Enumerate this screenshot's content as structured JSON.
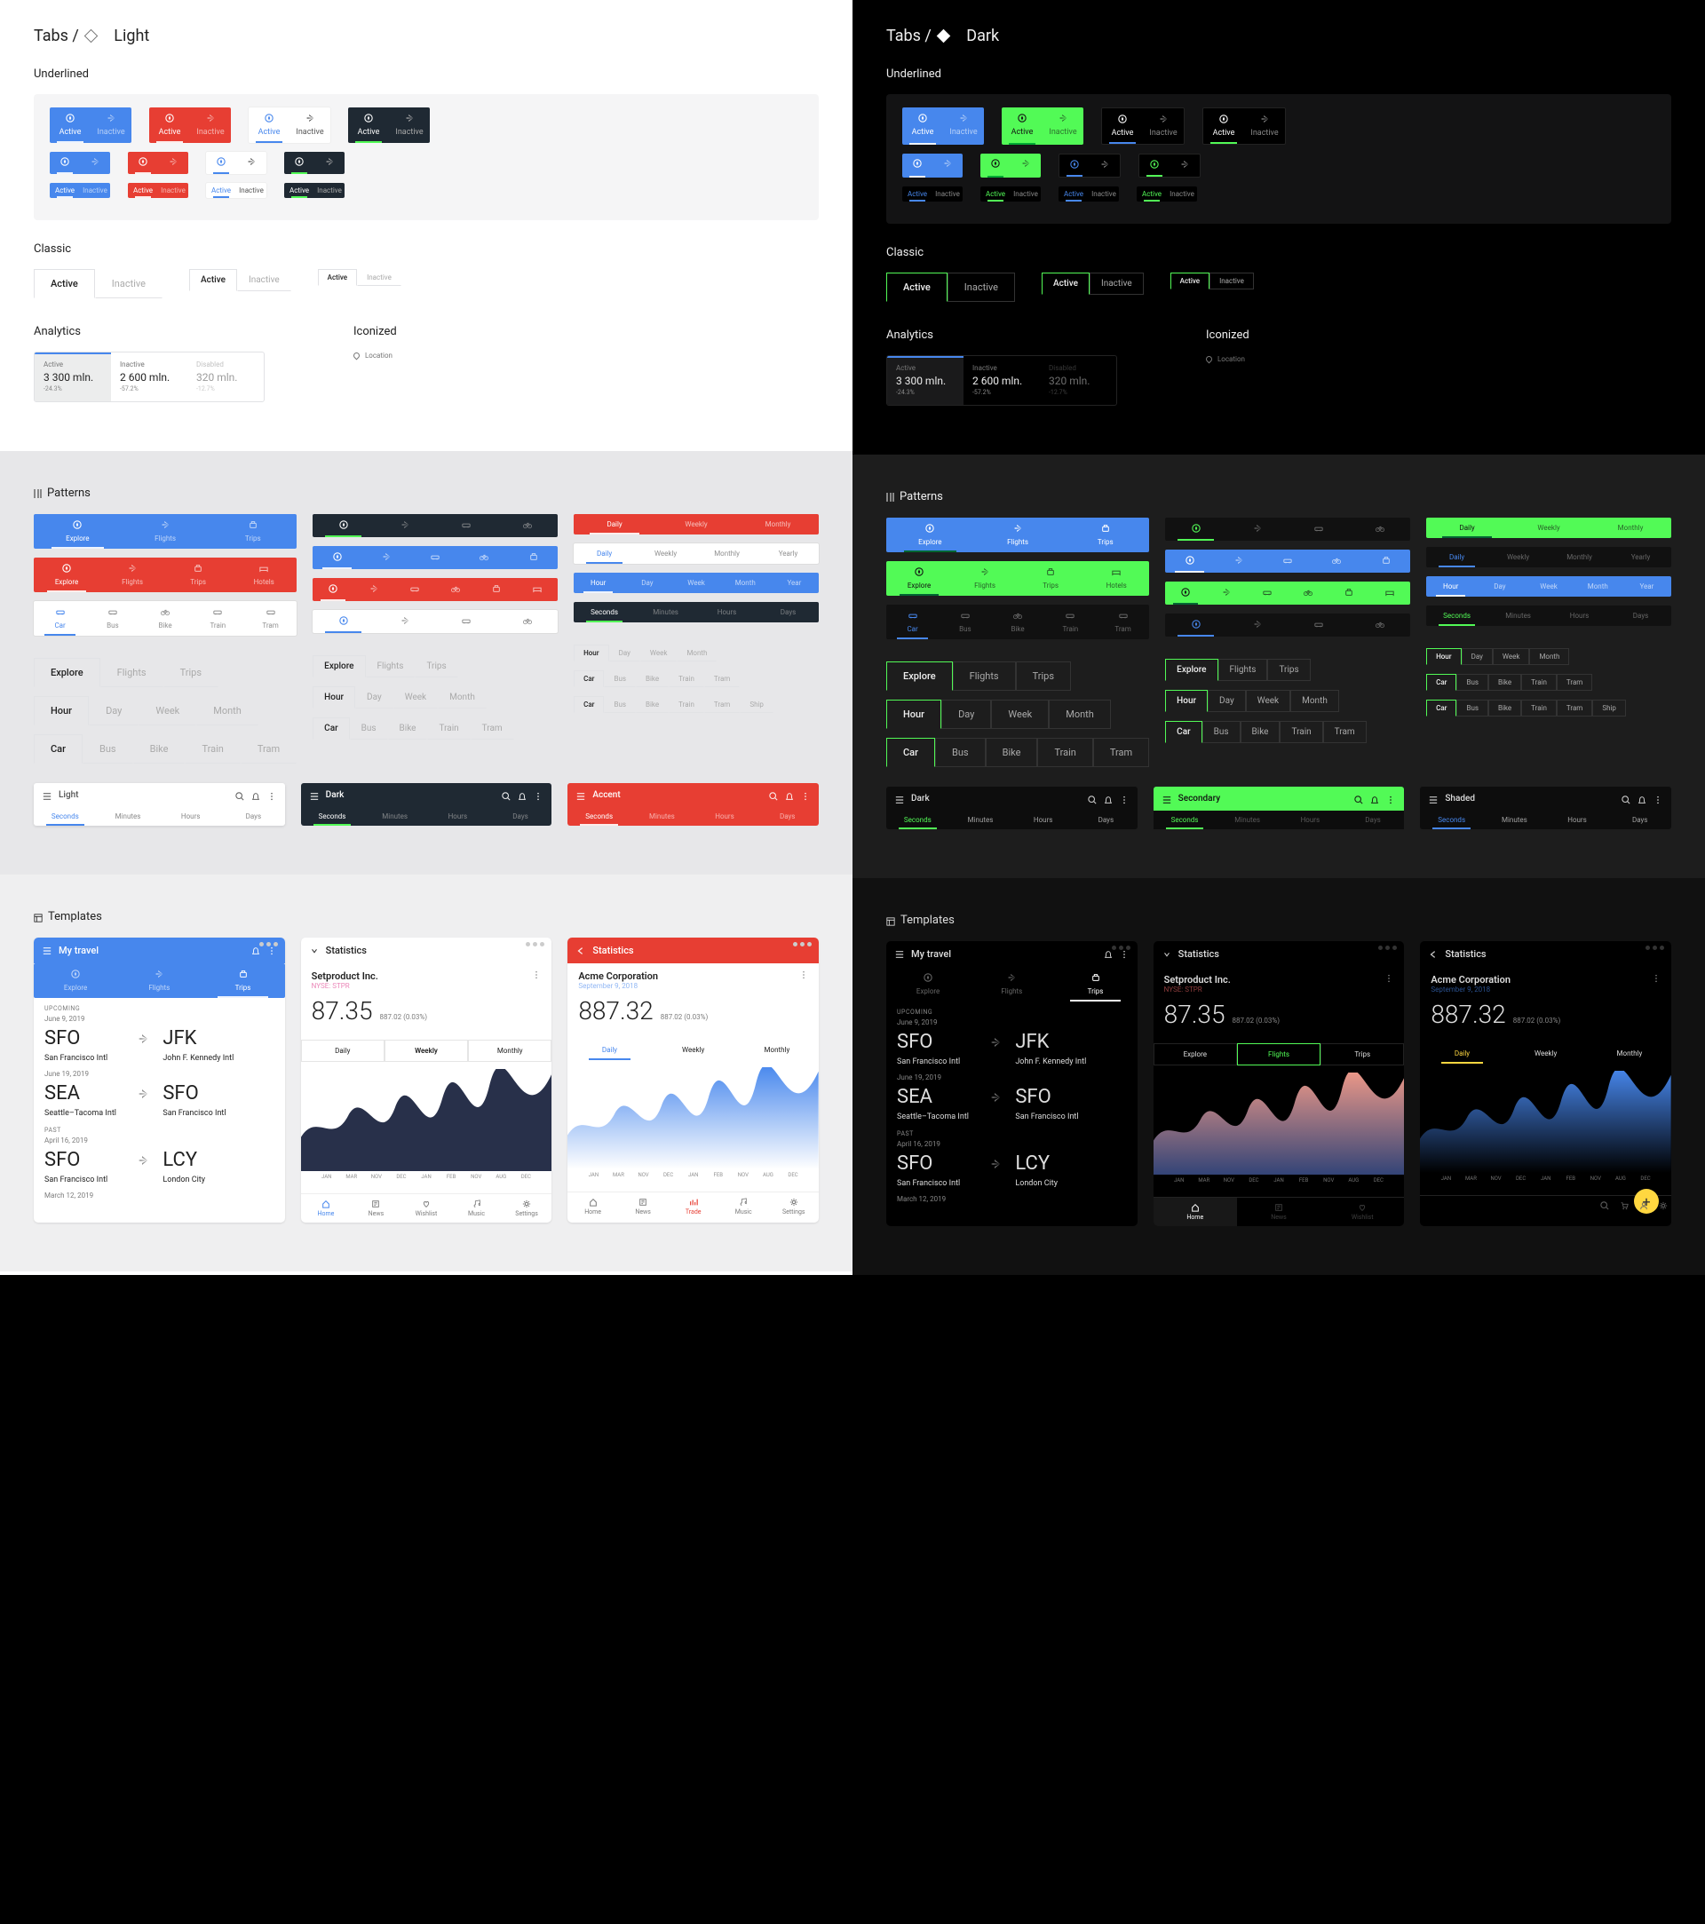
{
  "header": {
    "light_title": "Tabs / ",
    "light_suffix": "Light",
    "dark_title": "Tabs / ",
    "dark_suffix": "Dark"
  },
  "sections": {
    "underlined": "Underlined",
    "classic": "Classic",
    "analytics": "Analytics",
    "iconized": "Iconized",
    "patterns": "Patterns",
    "templates": "Templates",
    "location": "Location"
  },
  "tab": {
    "active": "Active",
    "inactive": "Inactive",
    "disabled": "Disabled"
  },
  "analytics": {
    "a_val": "3 300 mln.",
    "a_delta": "-24.3%",
    "b_val": "2 600 mln.",
    "b_delta": "-57.2%",
    "c_val": "320 mln.",
    "c_delta": "-12.7%"
  },
  "tabsA": [
    "Explore",
    "Flights",
    "Trips"
  ],
  "tabsB": [
    "Explore",
    "Flights",
    "Trips",
    "Hotels"
  ],
  "tabsT": [
    "Car",
    "Bus",
    "Bike",
    "Train",
    "Tram"
  ],
  "period3": [
    "Daily",
    "Weekly",
    "Monthly"
  ],
  "period4": [
    "Daily",
    "Weekly",
    "Monthly",
    "Yearly"
  ],
  "time5": [
    "Hour",
    "Day",
    "Week",
    "Month",
    "Year"
  ],
  "time4": [
    "Seconds",
    "Minutes",
    "Hours",
    "Days"
  ],
  "time4b": [
    "Hour",
    "Day",
    "Week",
    "Month"
  ],
  "transport6": [
    "Car",
    "Bus",
    "Bike",
    "Train",
    "Tram",
    "Ship"
  ],
  "appbars": {
    "light": "Light",
    "dark": "Dark",
    "accent": "Accent",
    "secondary": "Secondary",
    "shaded": "Shaded"
  },
  "travel": {
    "title": "My travel",
    "tabs": [
      "Explore",
      "Flights",
      "Trips"
    ],
    "upcoming": "UPCOMING",
    "past": "PAST",
    "d1": "June 9, 2019",
    "d2": "June 19, 2019",
    "d3": "April 16, 2019",
    "d4": "March 12, 2019",
    "sfo": "SFO",
    "jfk": "JFK",
    "sea": "SEA",
    "lcy": "LCY",
    "sfo_long": "San Francisco Intl",
    "jfk_long": "John F. Kennedy Intl",
    "sea_long": "Seattle–Tacoma Intl",
    "lcy_long": "London City"
  },
  "stats": {
    "title": "Statistics",
    "company_a": "Setproduct Inc.",
    "sub_a": "NYSE: STPR",
    "price_a": "87.35",
    "delta_a": "887.02 (0.03%)",
    "company_b": "Acme Corporation",
    "sub_b": "September 9, 2018",
    "price_b": "887.32",
    "delta_b": "887.02 (0.03%)",
    "tab3": [
      "Daily",
      "Weekly",
      "Monthly"
    ],
    "tab3b": [
      "Explore",
      "Flights",
      "Trips"
    ],
    "months": [
      "JAN",
      "MAR",
      "NOV",
      "DEC",
      "JAN",
      "FEB",
      "NOV",
      "AUG",
      "DEC"
    ]
  },
  "bnav": [
    "Home",
    "News",
    "Wishlist",
    "Music",
    "Settings"
  ],
  "bnav_b": [
    "Home",
    "News",
    "Trade",
    "Music",
    "Settings"
  ],
  "bnav_c": [
    "Home",
    "News",
    "Wishlist"
  ]
}
